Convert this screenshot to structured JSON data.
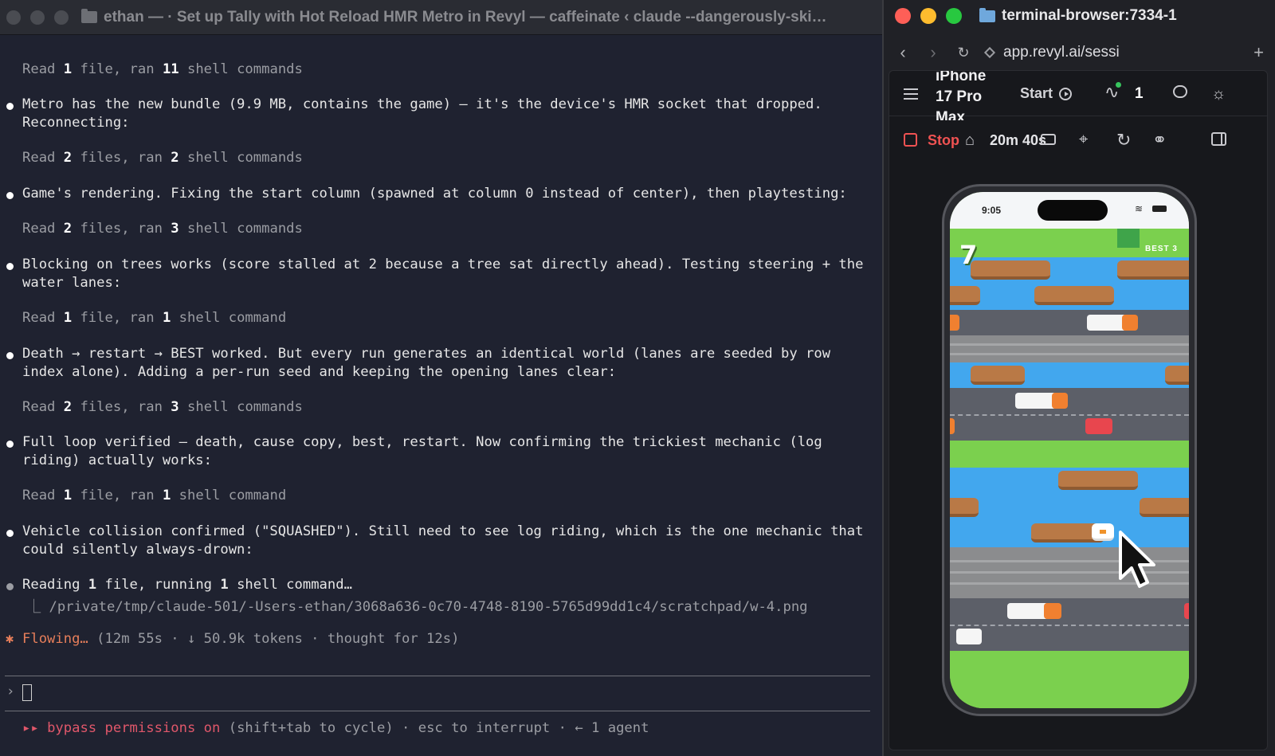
{
  "terminal": {
    "title": "ethan — · Set up Tally with Hot Reload HMR Metro in Revyl — caffeinate ‹ claude --dangerously-ski…",
    "lines": [
      {
        "kind": "tool",
        "pre": "Read ",
        "n1": "1",
        "mid": " file, ran ",
        "n2": "11",
        "post": " shell commands"
      },
      {
        "kind": "msg",
        "l1": "Metro has the new bundle (9.9 MB, contains the game) — it's the device's HMR socket that dropped.",
        "l2": "Reconnecting:"
      },
      {
        "kind": "tool",
        "pre": "Read ",
        "n1": "2",
        "mid": " files, ran ",
        "n2": "2",
        "post": " shell commands"
      },
      {
        "kind": "msg",
        "l1": "Game's rendering. Fixing the start column (spawned at column 0 instead of center), then playtesting:"
      },
      {
        "kind": "tool",
        "pre": "Read ",
        "n1": "2",
        "mid": " files, ran ",
        "n2": "3",
        "post": " shell commands"
      },
      {
        "kind": "msg",
        "l1": "Blocking on trees works (score stalled at 2 because a tree sat directly ahead). Testing steering + the",
        "l2": "water lanes:"
      },
      {
        "kind": "tool",
        "pre": "Read ",
        "n1": "1",
        "mid": " file, ran ",
        "n2": "1",
        "post": " shell command"
      },
      {
        "kind": "msg",
        "l1": "Death → restart → BEST worked. But every run generates an identical world (lanes are seeded by row",
        "l2": "index alone). Adding a per-run seed and keeping the opening lanes clear:"
      },
      {
        "kind": "tool",
        "pre": "Read ",
        "n1": "2",
        "mid": " files, ran ",
        "n2": "3",
        "post": " shell commands"
      },
      {
        "kind": "msg",
        "l1": "Full loop verified — death, cause copy, best, restart. Now confirming the trickiest mechanic (log",
        "l2": "riding) actually works:"
      },
      {
        "kind": "tool",
        "pre": "Read ",
        "n1": "1",
        "mid": " file, ran ",
        "n2": "1",
        "post": " shell command"
      },
      {
        "kind": "msg",
        "l1": "Vehicle collision confirmed (\"SQUASHED\"). Still need to see log riding, which is the one mechanic that",
        "l2": "could silently always-drown:"
      }
    ],
    "running": {
      "pre": "Reading ",
      "n1": "1",
      "mid": " file, running ",
      "n2": "1",
      "post": " shell command…",
      "path": "⎿ /private/tmp/claude-501/-Users-ethan/3068a636-0c70-4748-8190-5765d99dd1c4/scratchpad/w-4.png"
    },
    "status": {
      "word": "Flowing…",
      "detail": " (12m 55s · ↓ 50.9k tokens · thought for 12s)"
    },
    "prompt_symbol": "›",
    "footer": {
      "arrows": "▸▸",
      "mode": "bypass permissions on",
      "hint": " (shift+tab to cycle) · esc to interrupt · ← 1 agent"
    }
  },
  "browser": {
    "title": "terminal-browser:7334-1",
    "url": "app.revyl.ai/sessi",
    "device_name": "iPhone 17 Pro Max",
    "start_label": "Start",
    "activity_count": "1",
    "stop_label": "Stop",
    "timer": "20m 40s",
    "icons": [
      "menu-icon",
      "play-circle-icon",
      "activity-icon",
      "chat-icon",
      "sun-icon",
      "home-icon",
      "camera-icon",
      "pin-icon",
      "rotate-icon",
      "link-icon",
      "panel-icon"
    ]
  },
  "phone": {
    "time": "9:05",
    "score": "7",
    "best": "BEST 3"
  },
  "colors": {
    "accent_orange": "#e67e5a",
    "stop_red": "#f05252",
    "bypass_red": "#e0576a"
  }
}
